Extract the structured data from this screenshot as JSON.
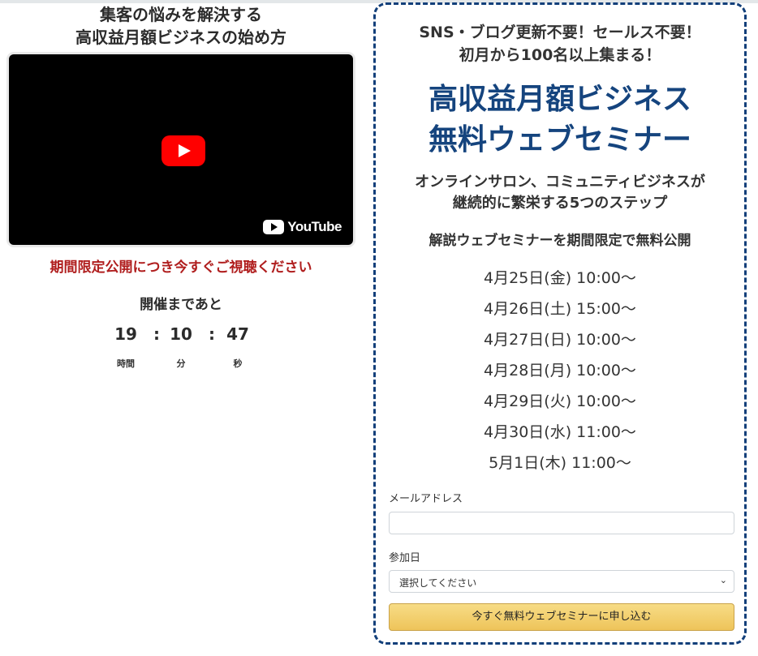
{
  "left": {
    "headline_line1": "集客の悩みを解決する",
    "headline_line2": "高収益月額ビジネスの始め方",
    "video": {
      "brand": "YouTube",
      "play_icon": "play-button-icon"
    },
    "limited_text": "期間限定公開につき今すぐご視聴ください",
    "countdown": {
      "label": "開催まであと",
      "hours": "19",
      "minutes": "10",
      "seconds": "47",
      "separator": ":",
      "hours_unit": "時間",
      "minutes_unit": "分",
      "seconds_unit": "秒"
    }
  },
  "panel": {
    "sub1_line1": "SNS・ブログ更新不要！セールス不要！",
    "sub1_line2": "初月から100名以上集まる！",
    "title_line1": "高収益月額ビジネス",
    "title_line2": "無料ウェブセミナー",
    "sub2_line1": "オンラインサロン、コミュニティビジネスが",
    "sub2_line2": "継続的に繁栄する5つのステップ",
    "sub3": "解説ウェブセミナーを期間限定で無料公開",
    "dates": [
      "4月25日(金) 10:00〜",
      "4月26日(土) 15:00〜",
      "4月27日(日) 10:00〜",
      "4月28日(月) 10:00〜",
      "4月29日(火) 10:00〜",
      "4月30日(水) 11:00〜",
      "5月1日(木) 11:00〜"
    ],
    "email_label": "メールアドレス",
    "email_value": "",
    "date_label": "参加日",
    "date_select_value": "選択してください",
    "submit_label": "今すぐ無料ウェブセミナーに申し込む"
  },
  "colors": {
    "title_blue": "#15447e",
    "warning_red": "#b01e1e",
    "border_blue": "#123f7a",
    "button_gold": "#eec45a"
  }
}
